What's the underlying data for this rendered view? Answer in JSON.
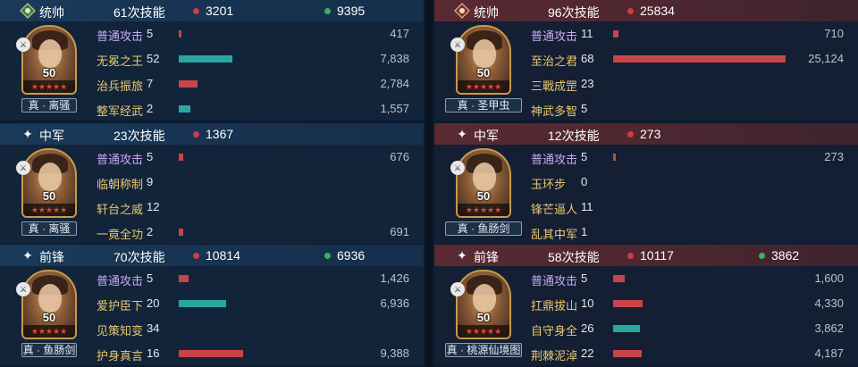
{
  "left": {
    "blocks": [
      {
        "rank": "统帅",
        "rank_icon": "commander-emblem-icon",
        "skill_count": "61次技能",
        "damage": "3201",
        "heal": "9395",
        "general": {
          "level": "50",
          "stars": "★★★★★",
          "name": "真 · 离骚"
        },
        "skills": [
          {
            "name": "普通攻击",
            "count": "5",
            "value": "417",
            "bar_type": "red",
            "bar": 0.012,
            "basic": true
          },
          {
            "name": "无冕之王",
            "count": "52",
            "value": "7,838",
            "bar_type": "teal",
            "bar": 0.24
          },
          {
            "name": "治兵振旅",
            "count": "7",
            "value": "2,784",
            "bar_type": "red",
            "bar": 0.085
          },
          {
            "name": "整军经武",
            "count": "2",
            "value": "1,557",
            "bar_type": "teal",
            "bar": 0.05
          }
        ]
      },
      {
        "rank": "中军",
        "rank_icon": "star-icon",
        "skill_count": "23次技能",
        "damage": "1367",
        "heal": "",
        "general": {
          "level": "50",
          "stars": "★★★★★",
          "name": "真 · 离骚"
        },
        "skills": [
          {
            "name": "普通攻击",
            "count": "5",
            "value": "676",
            "bar_type": "red",
            "bar": 0.02,
            "basic": true
          },
          {
            "name": "临朝称制",
            "count": "9",
            "value": "",
            "bar_type": "none",
            "bar": 0
          },
          {
            "name": "轩台之威",
            "count": "12",
            "value": "",
            "bar_type": "none",
            "bar": 0
          },
          {
            "name": "一竟全功",
            "count": "2",
            "value": "691",
            "bar_type": "red",
            "bar": 0.02
          }
        ]
      },
      {
        "rank": "前锋",
        "rank_icon": "star-icon",
        "skill_count": "70次技能",
        "damage": "10814",
        "heal": "6936",
        "general": {
          "level": "50",
          "stars": "★★★★★",
          "name": "真 · 鱼肠剑"
        },
        "skills": [
          {
            "name": "普通攻击",
            "count": "5",
            "value": "1,426",
            "bar_type": "red",
            "bar": 0.044,
            "basic": true
          },
          {
            "name": "爱护臣下",
            "count": "20",
            "value": "6,936",
            "bar_type": "teal",
            "bar": 0.213
          },
          {
            "name": "见策知变",
            "count": "34",
            "value": "",
            "bar_type": "none",
            "bar": 0
          },
          {
            "name": "护身真言",
            "count": "16",
            "value": "9,388",
            "bar_type": "red",
            "bar": 0.288
          }
        ]
      }
    ]
  },
  "right": {
    "blocks": [
      {
        "rank": "统帅",
        "rank_icon": "commander-emblem-icon",
        "skill_count": "96次技能",
        "damage": "25834",
        "heal": "",
        "general": {
          "level": "50",
          "stars": "★★★★★",
          "name": "真 · 圣甲虫"
        },
        "skills": [
          {
            "name": "普通攻击",
            "count": "11",
            "value": "710",
            "bar_type": "red",
            "bar": 0.022,
            "basic": true
          },
          {
            "name": "至治之君",
            "count": "68",
            "value": "25,124",
            "bar_type": "red",
            "bar": 0.77
          },
          {
            "name": "三戰成罡",
            "count": "23",
            "value": "",
            "bar_type": "none",
            "bar": 0
          },
          {
            "name": "神武多智",
            "count": "5",
            "value": "",
            "bar_type": "none",
            "bar": 0
          }
        ]
      },
      {
        "rank": "中军",
        "rank_icon": "star-icon",
        "skill_count": "12次技能",
        "damage": "273",
        "heal": "",
        "general": {
          "level": "50",
          "stars": "★★★★★",
          "name": "真 · 鱼肠剑"
        },
        "skills": [
          {
            "name": "普通攻击",
            "count": "5",
            "value": "273",
            "bar_type": "red",
            "bar": 0.008,
            "basic": true
          },
          {
            "name": "玉环步",
            "count": "0",
            "value": "",
            "bar_type": "none",
            "bar": 0
          },
          {
            "name": "锋芒逼人",
            "count": "11",
            "value": "",
            "bar_type": "none",
            "bar": 0
          },
          {
            "name": "乱其中军",
            "count": "1",
            "value": "",
            "bar_type": "none",
            "bar": 0
          }
        ]
      },
      {
        "rank": "前锋",
        "rank_icon": "star-icon",
        "skill_count": "58次技能",
        "damage": "10117",
        "heal": "3862",
        "general": {
          "level": "50",
          "stars": "★★★★★",
          "name": "真 · 桃源仙境图"
        },
        "skills": [
          {
            "name": "普通攻击",
            "count": "5",
            "value": "1,600",
            "bar_type": "red",
            "bar": 0.05,
            "basic": true
          },
          {
            "name": "扛鼎拔山",
            "count": "10",
            "value": "4,330",
            "bar_type": "red",
            "bar": 0.133
          },
          {
            "name": "自守身全",
            "count": "26",
            "value": "3,862",
            "bar_type": "teal",
            "bar": 0.118
          },
          {
            "name": "荆棘泥淖",
            "count": "22",
            "value": "4,187",
            "bar_type": "red",
            "bar": 0.128
          }
        ]
      }
    ]
  }
}
